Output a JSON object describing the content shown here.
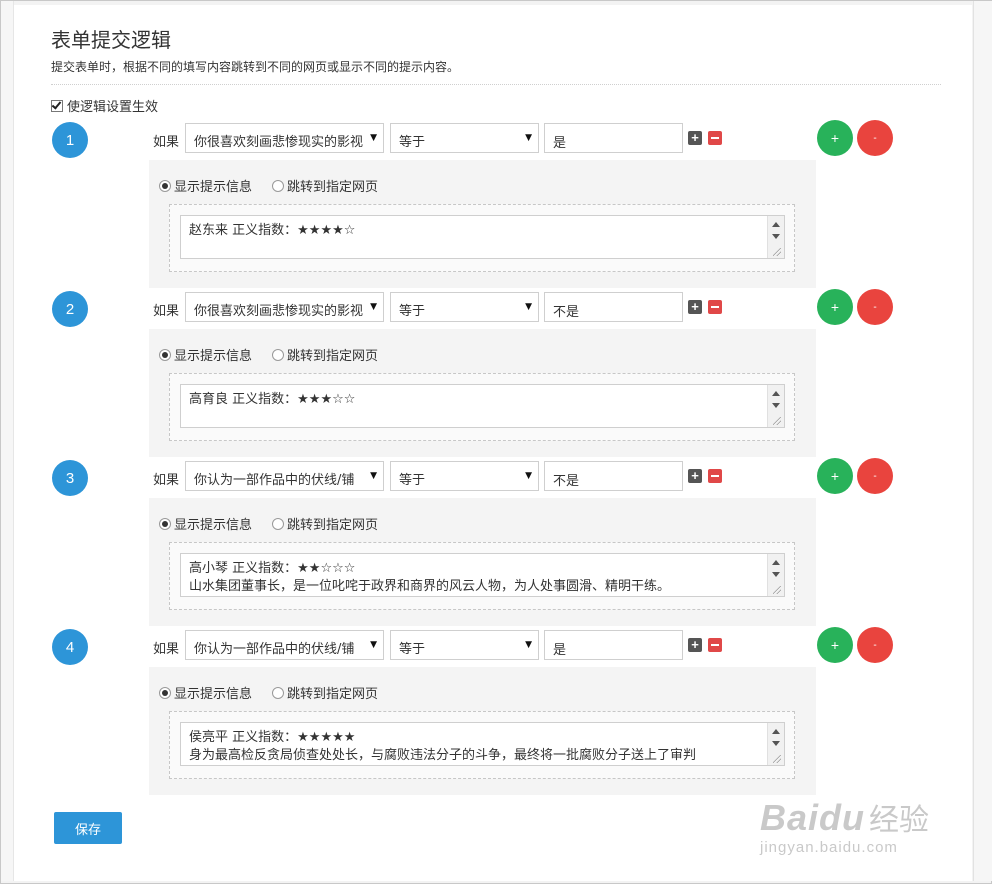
{
  "page": {
    "title": "表单提交逻辑",
    "subtitle": "提交表单时，根据不同的填写内容跳转到不同的网页或显示不同的提示内容。",
    "enable_label": "使逻辑设置生效",
    "enable_checked": true
  },
  "labels": {
    "if": "如果",
    "show_msg": "显示提示信息",
    "jump_page": "跳转到指定网页",
    "plus": "+",
    "minus": "-",
    "mini_plus": "+"
  },
  "rules": [
    {
      "num": "1",
      "field": "你很喜欢刻画悲惨现实的影视",
      "op": "等于",
      "value": "是",
      "action": "show_msg",
      "lines": [
        "赵东来 正义指数：★★★★☆",
        ""
      ]
    },
    {
      "num": "2",
      "field": "你很喜欢刻画悲惨现实的影视",
      "op": "等于",
      "value": "不是",
      "action": "show_msg",
      "lines": [
        "高育良 正义指数：★★★☆☆",
        ""
      ]
    },
    {
      "num": "3",
      "field": "你认为一部作品中的伏线/铺",
      "op": "等于",
      "value": "不是",
      "action": "show_msg",
      "lines": [
        "高小琴 正义指数：★★☆☆☆",
        "山水集团董事长，是一位叱咤于政界和商界的风云人物，为人处事圆滑、精明干练。"
      ]
    },
    {
      "num": "4",
      "field": "你认为一部作品中的伏线/铺",
      "op": "等于",
      "value": "是",
      "action": "show_msg",
      "lines": [
        "侯亮平 正义指数：★★★★★",
        "身为最高检反贪局侦查处处长，与腐败违法分子的斗争，最终将一批腐败分子送上了审判"
      ]
    }
  ],
  "save_label": "保存",
  "watermark": {
    "main": "Baidu",
    "cn": "经验",
    "url": "jingyan.baidu.com"
  },
  "colors": {
    "accent": "#2d95d8",
    "add": "#28b25a",
    "delete": "#e9443e"
  }
}
